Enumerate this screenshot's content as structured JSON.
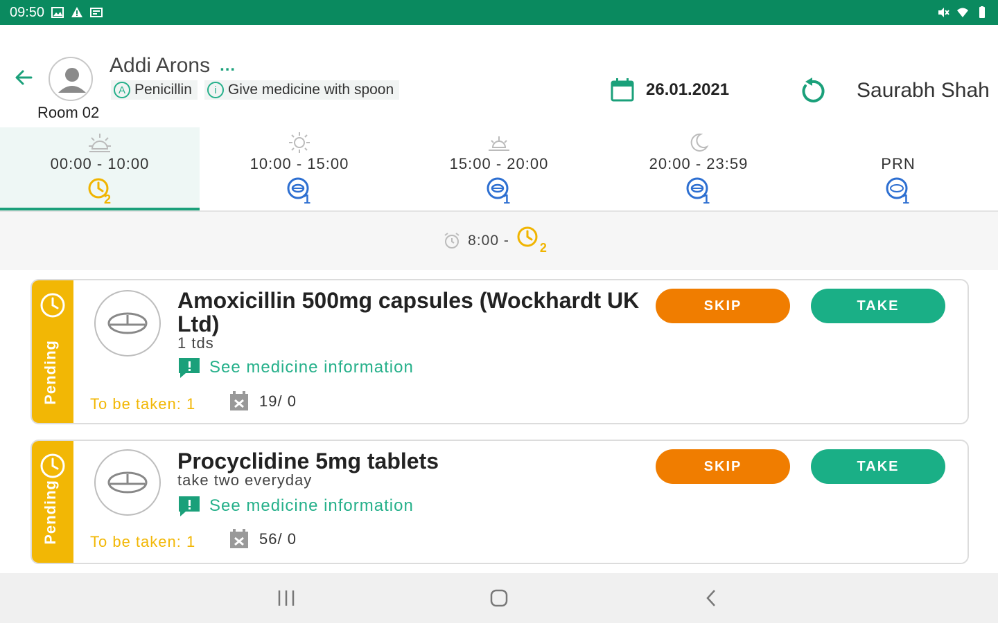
{
  "status_bar": {
    "time": "09:50"
  },
  "patient": {
    "name": "Addi Arons",
    "more": "...",
    "room": "Room 02",
    "tags": [
      {
        "icon_letter": "A",
        "text": "Penicillin"
      },
      {
        "icon_letter": "i",
        "text": "Give medicine with spoon"
      }
    ]
  },
  "header": {
    "date": "26.01.2021",
    "user": "Saurabh Shah"
  },
  "tabs": [
    {
      "label": "00:00 - 10:00",
      "icon": "sunrise-icon",
      "status_icon": "clock-icon",
      "count": "2",
      "active": true
    },
    {
      "label": "10:00 - 15:00",
      "icon": "sun-icon",
      "status_icon": "pill-icon",
      "count": "1",
      "active": false
    },
    {
      "label": "15:00 - 20:00",
      "icon": "sunset-icon",
      "status_icon": "pill-icon",
      "count": "1",
      "active": false
    },
    {
      "label": "20:00 - 23:59",
      "icon": "moon-icon",
      "status_icon": "pill-icon",
      "count": "1",
      "active": false
    },
    {
      "label": "PRN",
      "icon": "",
      "status_icon": "prn-icon",
      "count": "1",
      "active": false
    }
  ],
  "subband": {
    "time": "8:00 -",
    "count": "2"
  },
  "cards": [
    {
      "status": "Pending",
      "name": "Amoxicillin 500mg capsules (Wockhardt UK Ltd)",
      "dose": "1 tds",
      "info": "See medicine information",
      "to_be_taken": "To be taken: 1",
      "stock": "19/ 0",
      "skip": "SKIP",
      "take": "TAKE"
    },
    {
      "status": "Pending",
      "name": "Procyclidine 5mg tablets",
      "dose": "take two everyday",
      "info": "See medicine information",
      "to_be_taken": "To be taken: 1",
      "stock": "56/ 0",
      "skip": "SKIP",
      "take": "TAKE"
    }
  ],
  "colors": {
    "brand": "#0a8a5f",
    "accent": "#1aaf86",
    "pending": "#f2b705",
    "skip": "#f07d00",
    "prn_blue": "#2d6fd1"
  }
}
